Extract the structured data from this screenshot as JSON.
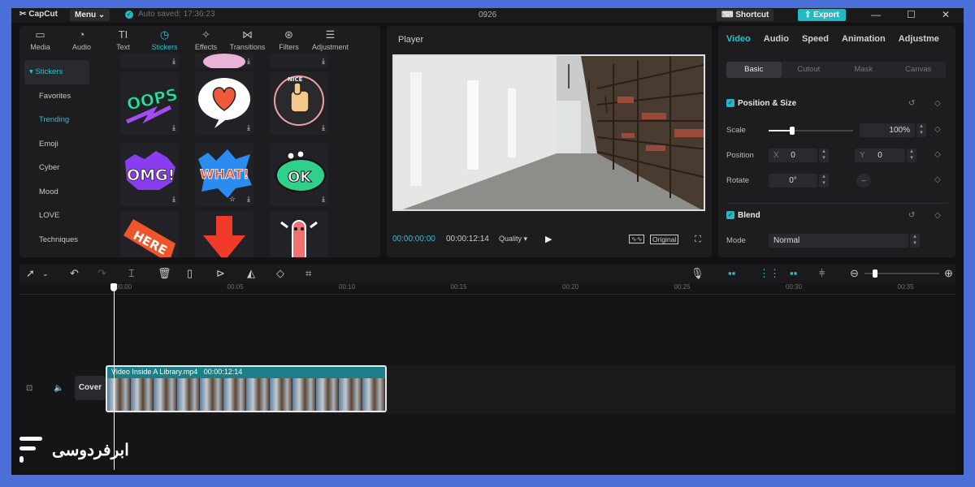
{
  "app": {
    "logo_text": "CapCut",
    "menu_label": "Menu",
    "autosave_text": "Auto saved: 17:36:23",
    "project_title": "0926",
    "shortcut_label": "Shortcut",
    "export_label": "Export"
  },
  "tools": [
    {
      "label": "Media",
      "icon": "media-icon",
      "glyph": "▭"
    },
    {
      "label": "Audio",
      "icon": "audio-icon",
      "glyph": "◔"
    },
    {
      "label": "Text",
      "icon": "text-icon",
      "glyph": "TI"
    },
    {
      "label": "Stickers",
      "icon": "sticker-icon",
      "glyph": "◷"
    },
    {
      "label": "Effects",
      "icon": "effects-icon",
      "glyph": "✧"
    },
    {
      "label": "Transitions",
      "icon": "transitions-icon",
      "glyph": "⋈"
    },
    {
      "label": "Filters",
      "icon": "filters-icon",
      "glyph": "⊛"
    },
    {
      "label": "Adjustment",
      "icon": "adjustment-icon",
      "glyph": "☰"
    }
  ],
  "active_tool": "Stickers",
  "categories": {
    "header": "▾ Stickers",
    "items": [
      "Favorites",
      "Trending",
      "Emoji",
      "Cyber",
      "Mood",
      "LOVE",
      "Techniques"
    ],
    "active": "Trending"
  },
  "stickers": [
    "OOPS",
    "NICE",
    "OMG!",
    "WHAT!",
    "OK",
    "HERE"
  ],
  "player": {
    "title": "Player",
    "current_time": "00:00:00:00",
    "duration": "00:00:12:14",
    "quality_label": "Quality",
    "original_label": "Original"
  },
  "inspector": {
    "tabs": [
      "Video",
      "Audio",
      "Speed",
      "Animation",
      "Adjustme"
    ],
    "active_tab": "Video",
    "subtabs": [
      "Basic",
      "Cutout",
      "Mask",
      "Canvas"
    ],
    "active_subtab": "Basic",
    "position_size_label": "Position & Size",
    "scale_label": "Scale",
    "scale_value": "100%",
    "scale_level": 0.28,
    "position_label": "Position",
    "x_label": "X",
    "x_value": "0",
    "y_label": "Y",
    "y_value": "0",
    "rotate_label": "Rotate",
    "rotate_value": "0°",
    "blend_label": "Blend",
    "mode_label": "Mode",
    "mode_value": "Normal"
  },
  "timeline": {
    "ticks": [
      "00:00",
      "00:05",
      "00:10",
      "00:15",
      "00:20",
      "00:25",
      "00:30",
      "00:35"
    ],
    "clip_name": "Video Inside A Library.mp4",
    "clip_duration": "00:00:12:14",
    "cover_label": "Cover"
  },
  "brand": {
    "text": "ابرفردوسی"
  },
  "colors": {
    "accent": "#22c4d4",
    "export": "#22b8c4",
    "frame_bg": "#4a6fd6"
  }
}
